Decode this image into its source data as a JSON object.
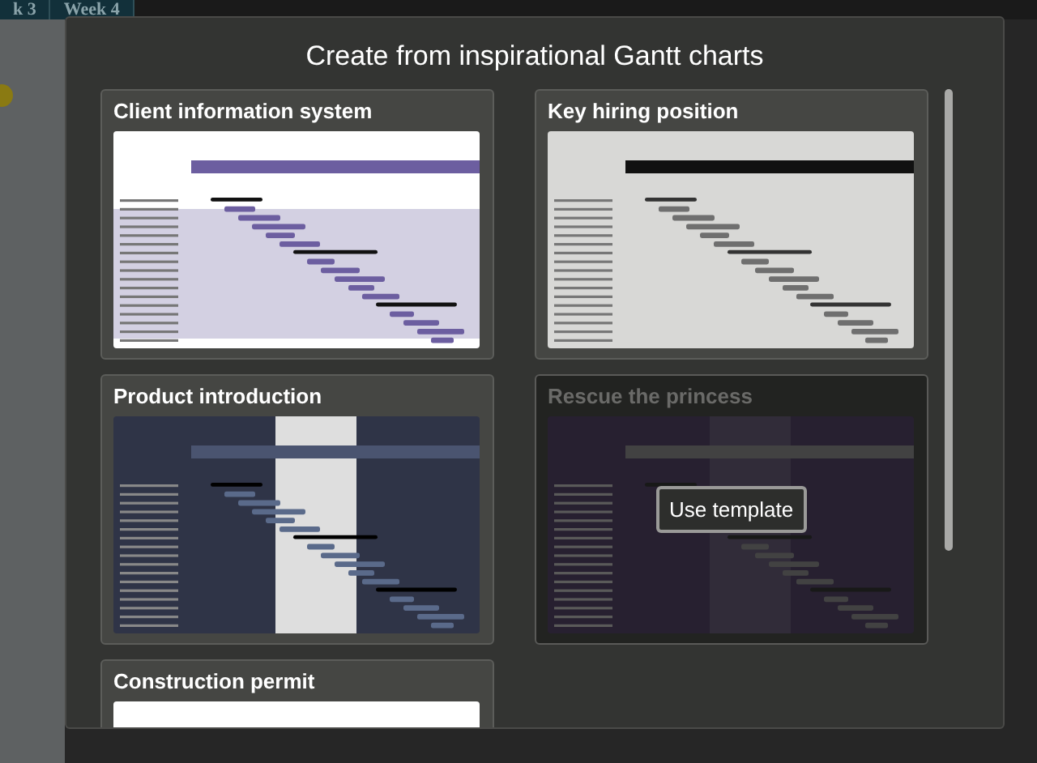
{
  "backdrop": {
    "column_headers": [
      "k 3",
      "Week 4"
    ]
  },
  "dialog": {
    "title": "Create from inspirational Gantt charts",
    "hover_button": "Use template",
    "templates": [
      {
        "title": "Client information system",
        "kind": "lavender",
        "hovered": false
      },
      {
        "title": "Key hiring position",
        "kind": "grey",
        "hovered": false
      },
      {
        "title": "Product introduction",
        "kind": "navy",
        "hovered": false
      },
      {
        "title": "Rescue the princess",
        "kind": "purple",
        "hovered": true
      },
      {
        "title": "Construction permit",
        "kind": "white",
        "hovered": false
      }
    ]
  }
}
